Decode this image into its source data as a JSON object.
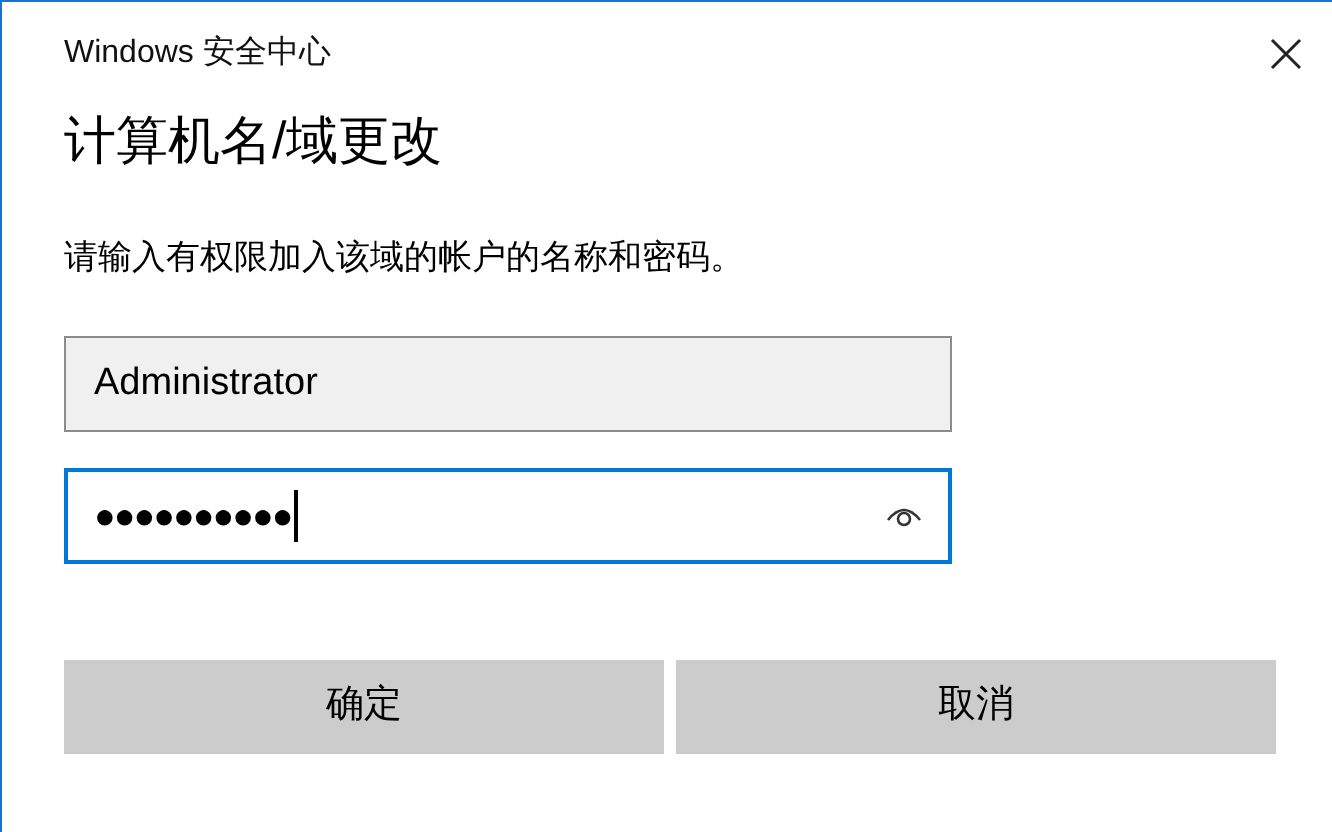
{
  "window": {
    "title": "Windows 安全中心"
  },
  "heading": "计算机名/域更改",
  "prompt": "请输入有权限加入该域的帐户的名称和密码。",
  "fields": [
    {
      "kind": "text",
      "value": "Administrator",
      "focused": false
    },
    {
      "kind": "password",
      "value": "●●●●●●●●●●",
      "focused": true
    }
  ],
  "buttons": [
    "确定",
    "取消"
  ]
}
